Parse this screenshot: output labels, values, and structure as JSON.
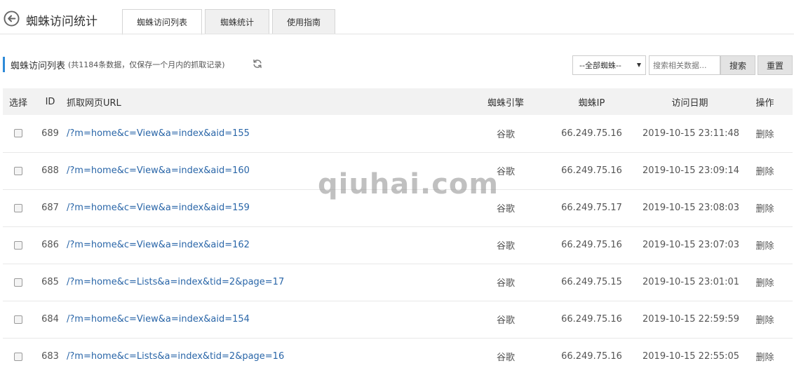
{
  "header": {
    "title": "蜘蛛访问统计",
    "tabs": [
      {
        "label": "蜘蛛访问列表",
        "active": true
      },
      {
        "label": "蜘蛛统计",
        "active": false
      },
      {
        "label": "使用指南",
        "active": false
      }
    ]
  },
  "toolbar": {
    "list_title": "蜘蛛访问列表",
    "list_subtitle": "(共1184条数据，仅保存一个月内的抓取记录)",
    "spider_select": "--全部蜘蛛--",
    "search_placeholder": "搜索相关数据...",
    "search_label": "搜索",
    "reset_label": "重置"
  },
  "table": {
    "columns": [
      "选择",
      "ID",
      "抓取网页URL",
      "蜘蛛引擎",
      "蜘蛛IP",
      "访问日期",
      "操作"
    ],
    "rows": [
      {
        "id": "689",
        "url": "/?m=home&c=View&a=index&aid=155",
        "engine": "谷歌",
        "ip": "66.249.75.16",
        "date": "2019-10-15 23:11:48",
        "op": "删除"
      },
      {
        "id": "688",
        "url": "/?m=home&c=View&a=index&aid=160",
        "engine": "谷歌",
        "ip": "66.249.75.16",
        "date": "2019-10-15 23:09:14",
        "op": "删除"
      },
      {
        "id": "687",
        "url": "/?m=home&c=View&a=index&aid=159",
        "engine": "谷歌",
        "ip": "66.249.75.17",
        "date": "2019-10-15 23:08:03",
        "op": "删除"
      },
      {
        "id": "686",
        "url": "/?m=home&c=View&a=index&aid=162",
        "engine": "谷歌",
        "ip": "66.249.75.16",
        "date": "2019-10-15 23:07:03",
        "op": "删除"
      },
      {
        "id": "685",
        "url": "/?m=home&c=Lists&a=index&tid=2&page=17",
        "engine": "谷歌",
        "ip": "66.249.75.15",
        "date": "2019-10-15 23:01:01",
        "op": "删除"
      },
      {
        "id": "684",
        "url": "/?m=home&c=View&a=index&aid=154",
        "engine": "谷歌",
        "ip": "66.249.75.16",
        "date": "2019-10-15 22:59:59",
        "op": "删除"
      },
      {
        "id": "683",
        "url": "/?m=home&c=Lists&a=index&tid=2&page=16",
        "engine": "谷歌",
        "ip": "66.249.75.16",
        "date": "2019-10-15 22:55:05",
        "op": "删除"
      }
    ]
  },
  "watermark": "qiuhai.com",
  "colors": {
    "accent": "#2e8ad8",
    "link": "#2a66a8",
    "header_bg": "#f2f2f2"
  },
  "icons": {
    "back": "back-arrow-icon",
    "refresh": "refresh-icon"
  }
}
